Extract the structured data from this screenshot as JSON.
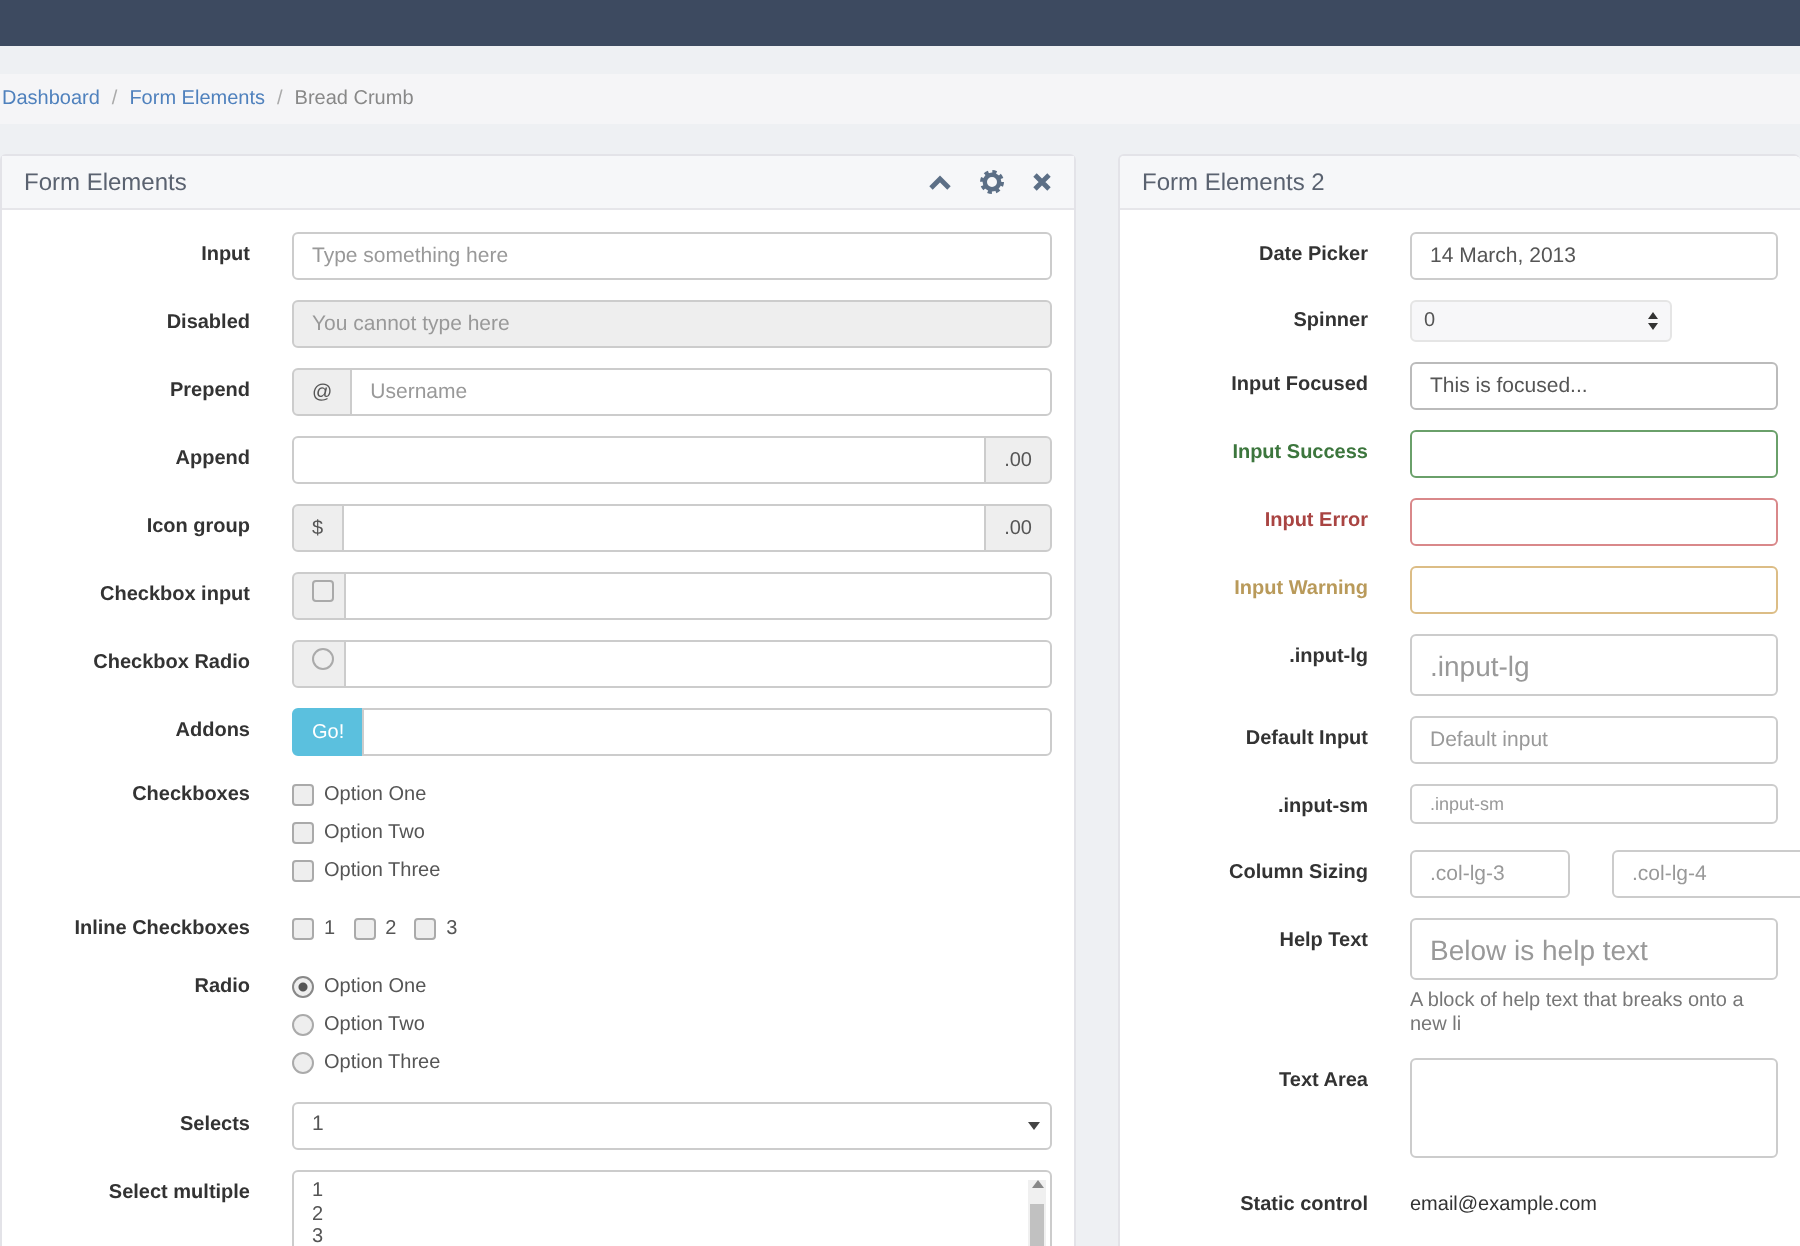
{
  "breadcrumb": [
    {
      "label": "Dashboard",
      "active": false
    },
    {
      "separator": "/",
      "label": "Form Elements",
      "active": false
    },
    {
      "separator": "/",
      "label": "Bread Crumb",
      "active": true
    }
  ],
  "panels": [
    {
      "title": "Form Elements",
      "tools": true,
      "rows": [
        {
          "kind": "text",
          "label": "Input",
          "placeholder": "Type something here",
          "disabled": false
        },
        {
          "kind": "text",
          "label": "Disabled",
          "placeholder": "You cannot type here",
          "disabled": true
        },
        {
          "kind": "group",
          "label": "Prepend",
          "prefix": "@",
          "placeholder": "Username"
        },
        {
          "kind": "group",
          "label": "Append",
          "suffix": ".00"
        },
        {
          "kind": "group",
          "label": "Icon group",
          "prefix": "$",
          "suffix": ".00"
        },
        {
          "kind": "check_addon",
          "label": "Checkbox input",
          "checked": false
        },
        {
          "kind": "radio_addon",
          "label": "Checkbox Radio",
          "checked": false
        },
        {
          "kind": "button_addon",
          "label": "Addons",
          "button": "Go!"
        },
        {
          "kind": "checkboxes",
          "label": "Checkboxes",
          "inline": false,
          "options": [
            {
              "label": "Option One",
              "checked": false
            },
            {
              "label": "Option Two",
              "checked": false
            },
            {
              "label": "Option Three",
              "checked": false
            }
          ]
        },
        {
          "kind": "checkboxes",
          "label": "Inline Checkboxes",
          "inline": true,
          "options": [
            {
              "label": "1",
              "checked": false
            },
            {
              "label": "2",
              "checked": false
            },
            {
              "label": "3",
              "checked": false
            }
          ]
        },
        {
          "kind": "radios",
          "label": "Radio",
          "options": [
            {
              "label": "Option One",
              "selected": true
            },
            {
              "label": "Option Two",
              "selected": false
            },
            {
              "label": "Option Three",
              "selected": false
            }
          ]
        },
        {
          "kind": "select",
          "label": "Selects",
          "value": "1"
        },
        {
          "kind": "multiselect",
          "label": "Select multiple",
          "options": [
            "1",
            "2",
            "3"
          ]
        }
      ]
    },
    {
      "title": "Form Elements 2",
      "tools": false,
      "rows": [
        {
          "kind": "text",
          "label": "Date Picker",
          "value": "14 March, 2013"
        },
        {
          "kind": "spinner",
          "label": "Spinner",
          "value": "0"
        },
        {
          "kind": "focused",
          "label": "Input Focused",
          "value": "This is focused..."
        },
        {
          "kind": "success",
          "label": "Input Success"
        },
        {
          "kind": "error",
          "label": "Input Error"
        },
        {
          "kind": "warning",
          "label": "Input Warning"
        },
        {
          "kind": "large",
          "label": ".input-lg",
          "placeholder": ".input-lg"
        },
        {
          "kind": "text",
          "label": "Default Input",
          "placeholder": "Default input"
        },
        {
          "kind": "small",
          "label": ".input-sm",
          "placeholder": ".input-sm"
        },
        {
          "kind": "columns",
          "label": "Column Sizing",
          "placeholders": [
            ".col-lg-3",
            ".col-lg-4"
          ]
        },
        {
          "kind": "large",
          "label": "Help Text",
          "placeholder": "Below is help text",
          "help": "A block of help text that breaks onto a new li"
        },
        {
          "kind": "textarea",
          "label": "Text Area"
        },
        {
          "kind": "static",
          "label": "Static control",
          "value": "email@example.com"
        }
      ]
    }
  ]
}
